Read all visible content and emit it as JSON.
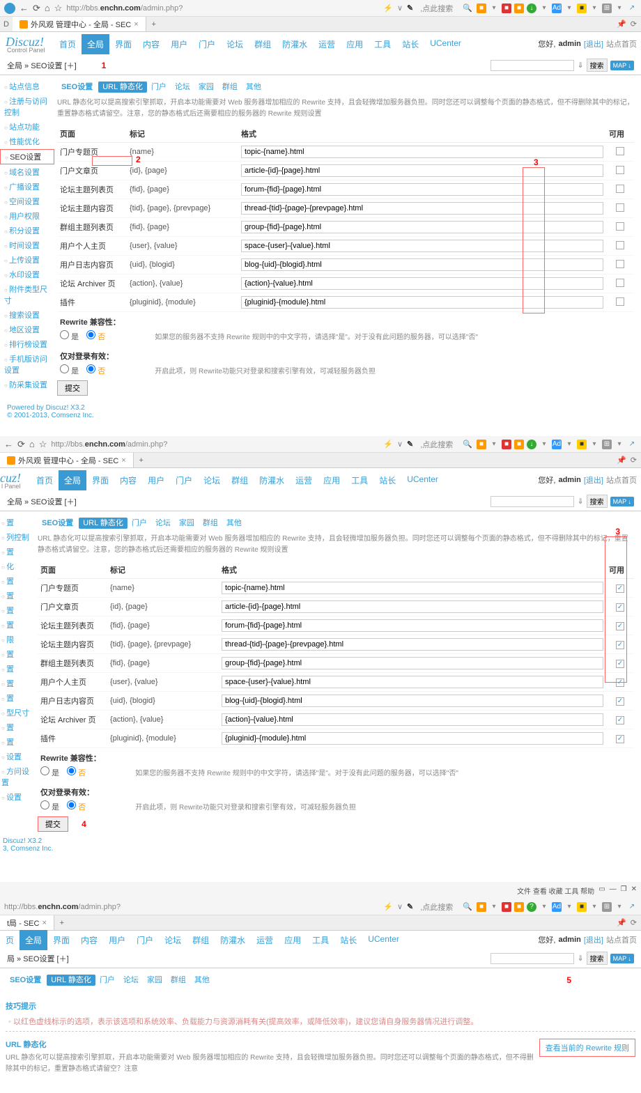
{
  "browser": {
    "url_prefix": "http://bbs.",
    "url_host": "enchn.com",
    "url_path": "/admin.php?",
    "search_hint": ",点此搜索",
    "tab_title": "外风观 管理中心 - 全局 - SEC",
    "tab_close": "×",
    "tab_add": "+"
  },
  "header": {
    "logo": "Discuz!",
    "cp": "Control Panel",
    "nav": [
      "首页",
      "全局",
      "界面",
      "内容",
      "用户",
      "门户",
      "论坛",
      "群组",
      "防灌水",
      "运营",
      "应用",
      "工具",
      "站长",
      "UCenter"
    ],
    "nav_active": 1,
    "greet": "您好,",
    "user": "admin",
    "logout": "[退出]",
    "home": "站点首页"
  },
  "breadcrumb": {
    "path": "全局 » SEO设置  [＋]",
    "path3": "局 » SEO设置  [＋]",
    "search_btn": "搜索",
    "map": "MAP ↓"
  },
  "sidebar1": [
    "站点信息",
    "注册与访问控制",
    "站点功能",
    "性能优化",
    "SEO设置",
    "域名设置",
    "广播设置",
    "空间设置",
    "用户权限",
    "积分设置",
    "时间设置",
    "上传设置",
    "水印设置",
    "附件类型尺寸",
    "搜索设置",
    "地区设置",
    "排行榜设置",
    "手机版访问设置",
    "防采集设置"
  ],
  "sidebar1_active": 4,
  "sidebar2_short": [
    "置",
    "列控制",
    "置",
    "化",
    "置",
    "置",
    "置",
    "置",
    "限",
    "置",
    "置",
    "置",
    "置",
    "型尺寸",
    "置",
    "置",
    "设置",
    "方问设置",
    "设置"
  ],
  "subtabs": {
    "title": "SEO设置",
    "tabs": [
      "URL 静态化",
      "门户",
      "论坛",
      "家园",
      "群组",
      "其他"
    ],
    "active": 0
  },
  "desc": "URL 静态化可以提高搜索引擎抓取，开启本功能需要对 Web 服务器增加相应的 Rewrite 支持，且会轻微增加服务器负担。同时您还可以调整每个页面的静态格式，但不得删除其中的标记，重置静态格式请留空。注意，您的静态格式后还需要相应的服务器的 Rewrite 规则设置",
  "table": {
    "head": [
      "页面",
      "标记",
      "格式",
      "可用"
    ],
    "rows": [
      {
        "page": "门户专题页",
        "tag": "{name}",
        "fmt": "topic-{name}.html"
      },
      {
        "page": "门户文章页",
        "tag": "{id}, {page}",
        "fmt": "article-{id}-{page}.html"
      },
      {
        "page": "论坛主题列表页",
        "tag": "{fid}, {page}",
        "fmt": "forum-{fid}-{page}.html"
      },
      {
        "page": "论坛主题内容页",
        "tag": "{tid}, {page}, {prevpage}",
        "fmt": "thread-{tid}-{page}-{prevpage}.html"
      },
      {
        "page": "群组主题列表页",
        "tag": "{fid}, {page}",
        "fmt": "group-{fid}-{page}.html"
      },
      {
        "page": "用户个人主页",
        "tag": "{user}, {value}",
        "fmt": "space-{user}-{value}.html"
      },
      {
        "page": "用户日志内容页",
        "tag": "{uid}, {blogid}",
        "fmt": "blog-{uid}-{blogid}.html"
      },
      {
        "page": "论坛 Archiver 页",
        "tag": "{action}, {value}",
        "fmt": "{action}-{value}.html"
      },
      {
        "page": "插件",
        "tag": "{pluginid}, {module}",
        "fmt": "{pluginid}-{module}.html"
      }
    ]
  },
  "options": {
    "rewrite_compat": "Rewrite 兼容性：",
    "only_login": "仅对登录有效：",
    "yes": "是",
    "no": "否",
    "hint1": "如果您的服务器不支持 Rewrite 规则中的中文字符，请选择\"是\"。对于没有此问题的服务器，可以选择\"否\"",
    "hint2": "开启此项，则 Rewrite功能只对登录和搜索引擎有效，可减轻服务器负担",
    "submit": "提交"
  },
  "footer": {
    "powered": "Powered by Discuz! X3.2",
    "copy": "© 2001-2013, Comsenz Inc.",
    "short1": "Discuz! X3.2",
    "short2": "3, Comsenz Inc."
  },
  "callouts": {
    "c1": "1",
    "c2": "2",
    "c3": "3",
    "c4": "4",
    "c5": "5"
  },
  "panel3": {
    "top_tabs": "文件  查看  收藏  工具  帮助",
    "breadcrumb": "t局 - SEC",
    "tips_title": "技巧提示",
    "tips_text": "◦ 以红色虚线标示的选项，表示该选项和系统效率、负载能力与资源消耗有关(提高效率，或降低效率)，建议您请自身服务器情况进行调整。",
    "url_title": "URL 静态化",
    "view_rules": "查看当前的 Rewrite 规则",
    "url_desc": "URL 静态化可以提高搜索引擎抓取，开启本功能需要对 Web 服务器增加相应的 Rewrite 支持，且会轻微增加服务器负担。同时您还可以调整每个页面的静态格式，但不得删除其中的标记，重置静态格式请留空？注意"
  }
}
